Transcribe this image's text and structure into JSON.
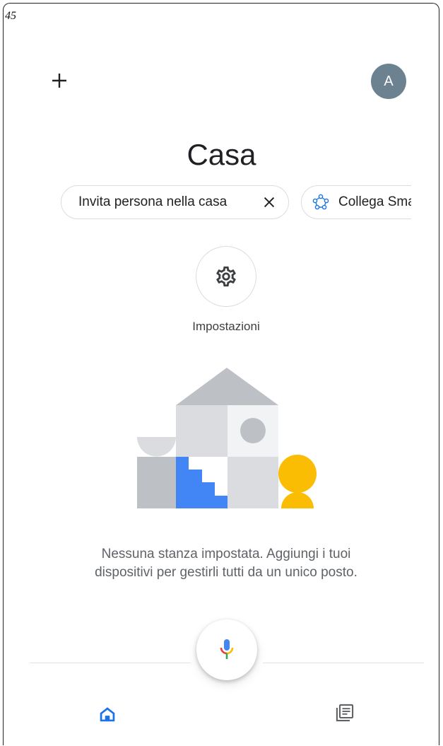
{
  "corner_label": "45",
  "header": {
    "avatar_initial": "A"
  },
  "home": {
    "title": "Casa"
  },
  "chips": [
    {
      "label": "Invita persona nella casa",
      "icon": "close-icon"
    },
    {
      "label": "Collega Smart Home",
      "icon": "network-icon"
    }
  ],
  "settings": {
    "label": "Impostazioni",
    "icon": "gear-icon"
  },
  "empty_state": {
    "line1": "Nessuna stanza impostata. Aggiungi i tuoi",
    "line2": "dispositivi per gestirli tutti da un unico posto."
  },
  "bottom_nav": {
    "items": [
      {
        "name": "home",
        "icon": "home-icon",
        "active": true
      },
      {
        "name": "feed",
        "icon": "feed-icon",
        "active": false
      }
    ],
    "mic_icon": "microphone-icon"
  },
  "colors": {
    "accent_blue": "#4285f4",
    "avatar_bg": "#6d8291",
    "illustration_yellow": "#fbbc04",
    "illustration_gray": "#bdc1c6"
  }
}
